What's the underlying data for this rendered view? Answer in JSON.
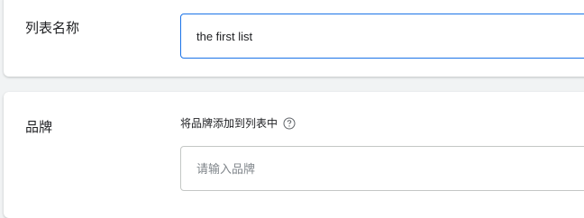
{
  "list_name_section": {
    "label": "列表名称",
    "input_value": "the first list"
  },
  "brand_section": {
    "label": "品牌",
    "hint": "将品牌添加到列表中",
    "input_placeholder": "请输入品牌",
    "hint_icon": "help-circle-icon"
  },
  "colors": {
    "accent": "#1a73e8",
    "background": "#f1f3f4",
    "border": "#c4c7c5"
  }
}
